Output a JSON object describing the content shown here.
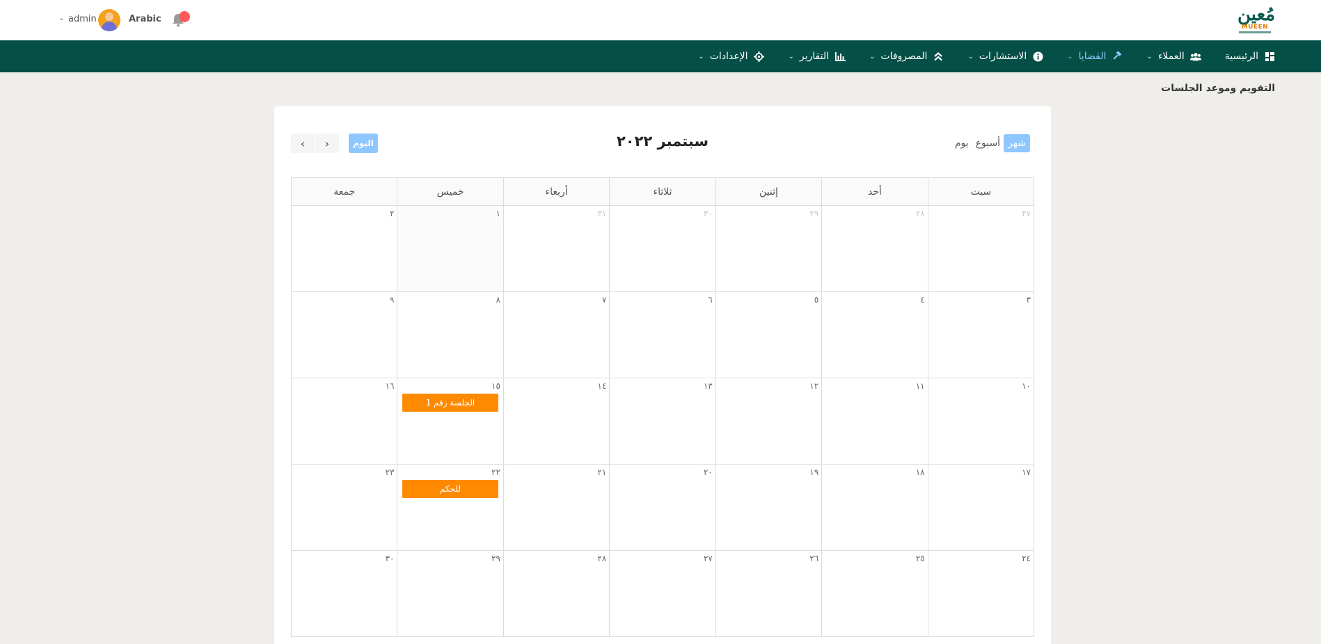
{
  "header": {
    "logo_ar": "مُعين",
    "logo_en": "MUEEN",
    "language": "Arabic",
    "user_name": "admin"
  },
  "nav": {
    "items": [
      {
        "label": "الرئيسية",
        "icon": "dashboard-icon",
        "has_dropdown": false
      },
      {
        "label": "العملاء",
        "icon": "users-icon",
        "has_dropdown": true
      },
      {
        "label": "القضايا",
        "icon": "gavel-icon",
        "has_dropdown": true,
        "active": true
      },
      {
        "label": "الاستشارات",
        "icon": "info-icon",
        "has_dropdown": true
      },
      {
        "label": "المصروفات",
        "icon": "angles-up-icon",
        "has_dropdown": true
      },
      {
        "label": "التقارير",
        "icon": "chart-icon",
        "has_dropdown": true
      },
      {
        "label": "الإعدادات",
        "icon": "gear-icon",
        "has_dropdown": true
      }
    ]
  },
  "page": {
    "title": "التقويم وموعد الجلسات"
  },
  "calendar": {
    "title": "سبتمبر ٢٠٢٢",
    "views": {
      "day": "يوم",
      "week": "أسبوع",
      "month": "شهر"
    },
    "active_view": "month",
    "today_label": "اليوم",
    "weekdays": [
      "سبت",
      "أحد",
      "إثنين",
      "ثلاثاء",
      "أربعاء",
      "خميس",
      "جمعة"
    ],
    "weeks": [
      [
        {
          "num": "٢٧",
          "other": true
        },
        {
          "num": "٢٨",
          "other": true
        },
        {
          "num": "٢٩",
          "other": true
        },
        {
          "num": "٣٠",
          "other": true
        },
        {
          "num": "٣١",
          "other": true
        },
        {
          "num": "١",
          "today": true
        },
        {
          "num": "٢"
        }
      ],
      [
        {
          "num": "٣"
        },
        {
          "num": "٤"
        },
        {
          "num": "٥"
        },
        {
          "num": "٦"
        },
        {
          "num": "٧"
        },
        {
          "num": "٨"
        },
        {
          "num": "٩"
        }
      ],
      [
        {
          "num": "١٠"
        },
        {
          "num": "١١"
        },
        {
          "num": "١٢"
        },
        {
          "num": "١٣"
        },
        {
          "num": "١٤"
        },
        {
          "num": "١٥",
          "event": "الجلسة رقم 1"
        },
        {
          "num": "١٦"
        }
      ],
      [
        {
          "num": "١٧"
        },
        {
          "num": "١٨"
        },
        {
          "num": "١٩"
        },
        {
          "num": "٢٠"
        },
        {
          "num": "٢١"
        },
        {
          "num": "٢٢",
          "event": "للحكم"
        },
        {
          "num": "٢٣"
        }
      ],
      [
        {
          "num": "٢٤"
        },
        {
          "num": "٢٥"
        },
        {
          "num": "٢٦"
        },
        {
          "num": "٢٧"
        },
        {
          "num": "٢٨"
        },
        {
          "num": "٢٩"
        },
        {
          "num": "٣٠"
        }
      ]
    ]
  },
  "colors": {
    "nav_bg": "#054f46",
    "accent": "#8ec7ff",
    "event": "#ff8a00",
    "notification": "#ff5a5a"
  }
}
